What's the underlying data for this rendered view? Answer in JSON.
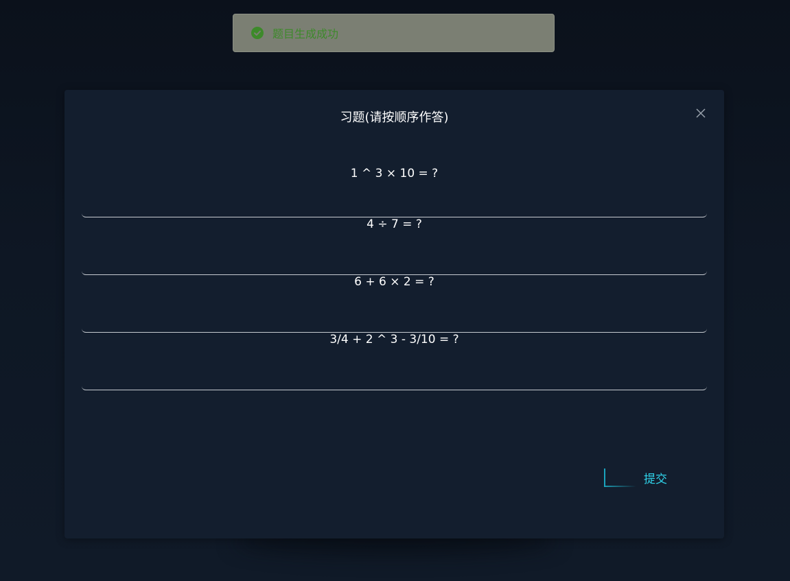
{
  "toast": {
    "message": "题目生成成功",
    "icon": "check-circle-icon",
    "type": "success"
  },
  "dialog": {
    "title": "习题(请按顺序作答)",
    "close_icon": "close-icon",
    "questions": [
      {
        "text": "1 ^ 3 × 10 = ?",
        "answer": ""
      },
      {
        "text": "4 ÷ 7 = ?",
        "answer": ""
      },
      {
        "text": "6 + 6 × 2 = ?",
        "answer": ""
      },
      {
        "text": "3/4 + 2 ^ 3 - 3/10 = ?",
        "answer": ""
      }
    ],
    "submit_label": "提交"
  },
  "colors": {
    "background": "#0e1724",
    "dialog_bg": "#131e2e",
    "accent": "#2fd3ea",
    "toast_bg": "#7b7f73",
    "success": "#3d8a2a"
  }
}
